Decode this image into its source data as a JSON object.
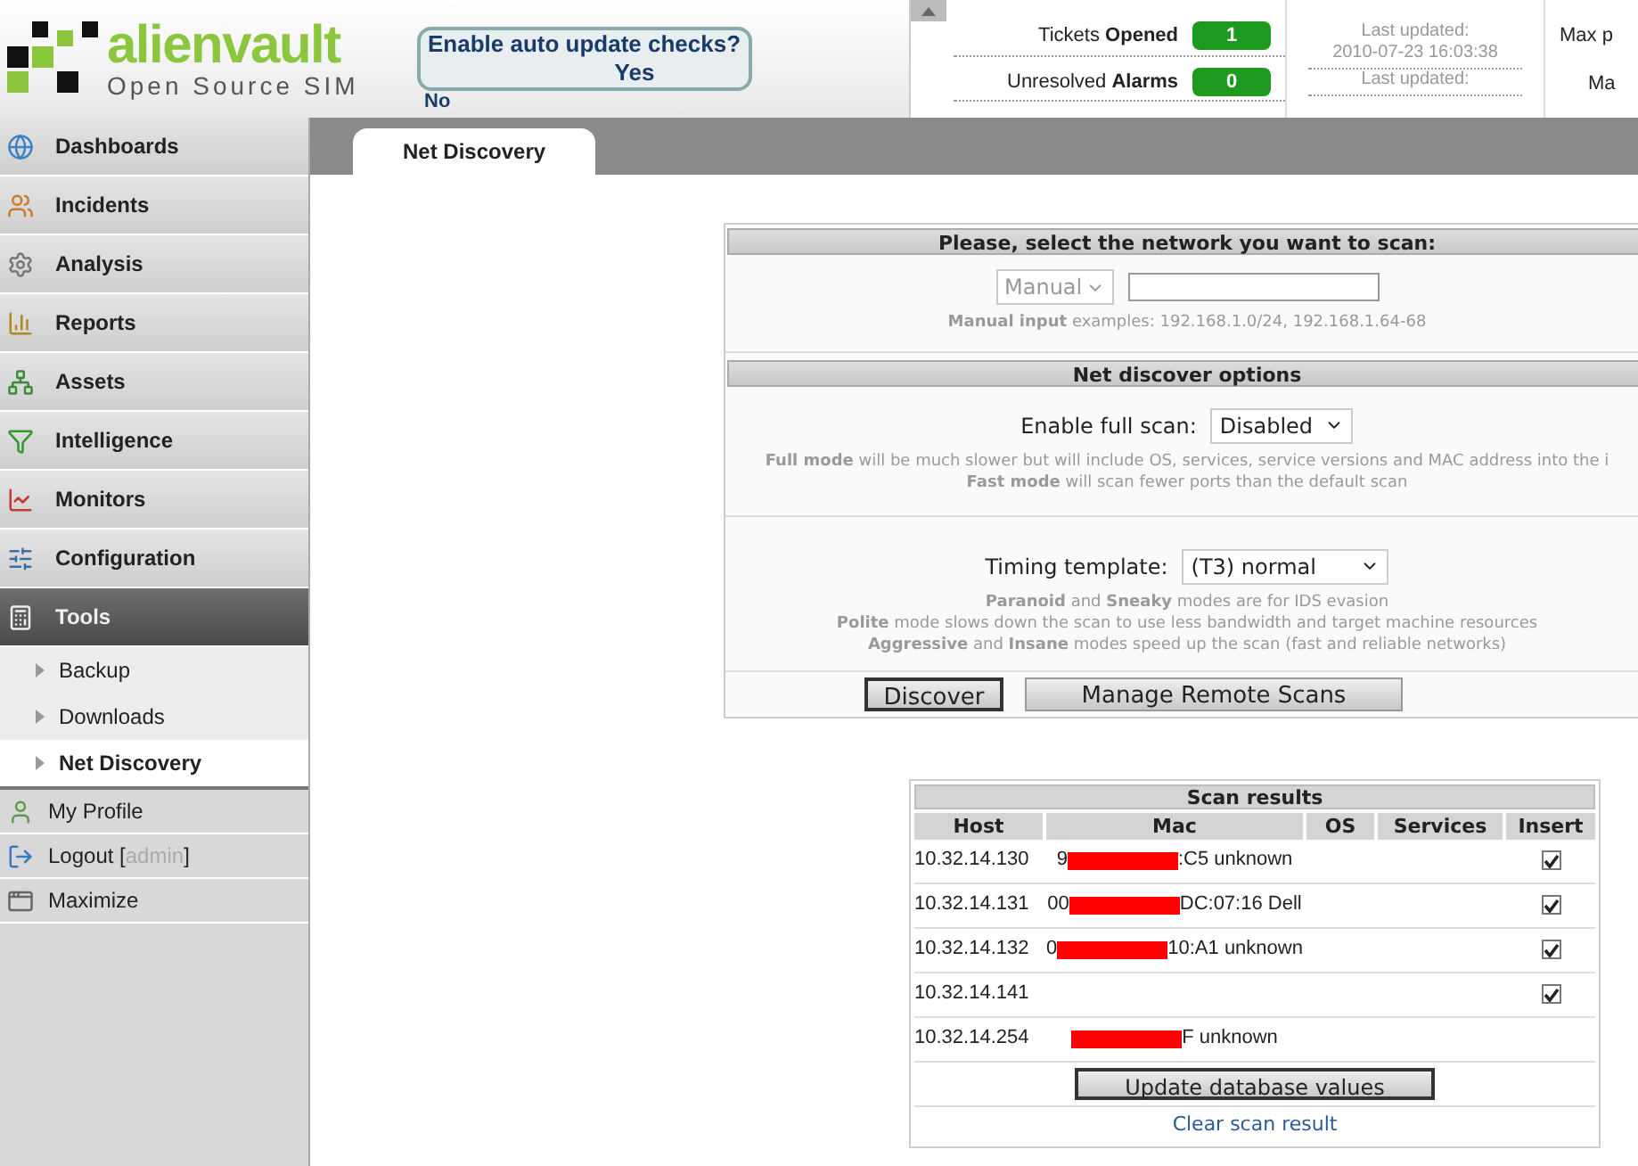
{
  "header": {
    "logo": {
      "name": "alienvault",
      "tagline": "Open Source SIM"
    },
    "update_prompt": {
      "question": "Enable auto update checks?",
      "yes": "Yes",
      "no": "No"
    },
    "stats": [
      {
        "label": "Tickets ",
        "bold": "Opened",
        "value": "1",
        "updated_label": "Last updated:",
        "updated_value": "2010-07-23 16:03:38",
        "extra": "Max p"
      },
      {
        "label": "Unresolved ",
        "bold": "Alarms",
        "value": "0",
        "updated_label": "Last updated:",
        "extra": "Ma"
      }
    ]
  },
  "sidebar": {
    "items": [
      {
        "label": "Dashboards",
        "selected": false
      },
      {
        "label": "Incidents",
        "selected": false
      },
      {
        "label": "Analysis",
        "selected": false
      },
      {
        "label": "Reports",
        "selected": false
      },
      {
        "label": "Assets",
        "selected": false
      },
      {
        "label": "Intelligence",
        "selected": false
      },
      {
        "label": "Monitors",
        "selected": false
      },
      {
        "label": "Configuration",
        "selected": false
      },
      {
        "label": "Tools",
        "selected": true,
        "children": [
          {
            "label": "Backup",
            "selected": false
          },
          {
            "label": "Downloads",
            "selected": false
          },
          {
            "label": "Net Discovery",
            "selected": true
          }
        ]
      }
    ],
    "footer": [
      {
        "label": "My Profile"
      },
      {
        "label": "Logout [",
        "user": "admin",
        "end": "]"
      },
      {
        "label": "Maximize"
      }
    ]
  },
  "tabs": [
    {
      "label": "Net Discovery",
      "selected": true
    }
  ],
  "scan_form": {
    "title": "Please, select the network you want to scan:",
    "mode": "Manual",
    "hint": "**Manual input** examples: 192.168.1.0/24, 192.168.1.64-68",
    "options_title": "Net discover options",
    "full_scan_label": "Enable full scan:",
    "full_scan": "Disabled",
    "full_scan_notes": [
      "**Full mode** will be much slower but will include OS, services, service versions and MAC address into the i",
      "**Fast mode** will scan fewer ports than the default scan"
    ],
    "timing_label": "Timing template:",
    "timing": "(T3) normal",
    "timing_notes": [
      "**Paranoid** and **Sneaky** modes are for IDS evasion",
      "**Polite** mode slows down the scan to use less bandwidth and target machine resources",
      "**Aggressive** and **Insane** modes speed up the scan (fast and reliable networks)"
    ],
    "buttons": [
      "Discover",
      "Manage Remote Scans"
    ]
  },
  "results": {
    "title": "Scan results",
    "columns": [
      "Host",
      "Mac",
      "OS",
      "Services",
      "Insert"
    ],
    "rows": [
      {
        "host": "10.32.14.130",
        "mac_start": "9",
        "mac_end": ":C5 unknown",
        "redacted": true,
        "kind": "checkbox",
        "checked": true
      },
      {
        "host": "10.32.14.131",
        "mac_start": "00",
        "mac_end": "DC:07:16 Dell",
        "redacted": true,
        "kind": "checkbox",
        "checked": true
      },
      {
        "host": "10.32.14.132",
        "mac_start": "0",
        "mac_end": "10:A1 unknown",
        "redacted": true,
        "kind": "checkbox",
        "checked": true
      },
      {
        "host": "10.32.14.141",
        "redacted": false,
        "kind": "checkbox",
        "checked": true
      },
      {
        "host": "10.32.14.254",
        "mac_end": "F unknown",
        "redacted": true,
        "kind": "plain"
      }
    ],
    "update_button": "Update database values",
    "clear_link": "Clear scan result"
  }
}
